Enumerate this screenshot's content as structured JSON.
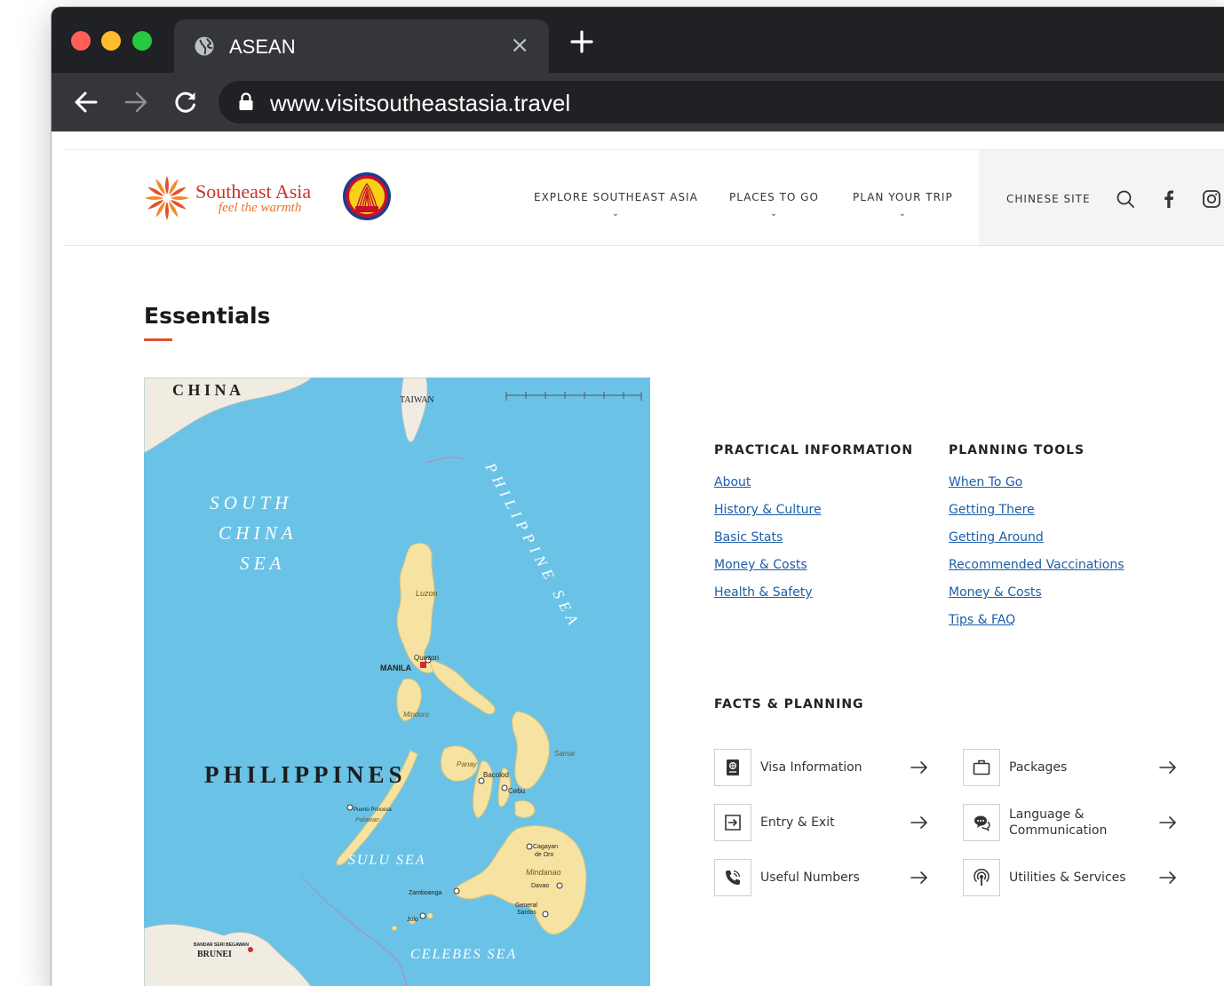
{
  "browser": {
    "tab_title": "ASEAN",
    "tab_close": "×",
    "url": "www.visitsoutheastasia.travel"
  },
  "header": {
    "brand_name": "Southeast Asia",
    "brand_tagline": "feel the warmth",
    "asean_logo_text": "asean",
    "nav": [
      {
        "label": "EXPLORE SOUTHEAST ASIA",
        "chevron": "⌄"
      },
      {
        "label": "PLACES TO GO",
        "chevron": "⌄"
      },
      {
        "label": "PLAN YOUR TRIP",
        "chevron": "⌄"
      }
    ],
    "chinese_site": "CHINESE SITE",
    "icons": [
      "search-icon",
      "facebook-icon",
      "instagram-icon"
    ]
  },
  "essentials": {
    "title": "Essentials",
    "accent_color": "#e1522c",
    "link_color": "#1c5ea8"
  },
  "map": {
    "labels": {
      "china": "C H I N A",
      "taiwan": "TAIWAN",
      "south_china_sea_1": "S O U T H",
      "south_china_sea_2": "C H I N A",
      "south_china_sea_3": "S E A",
      "philippine_sea": "PHILIPPINE SEA",
      "luzon": "Luzon",
      "quezon": "Quezon",
      "manila": "MANILA",
      "mindoro": "Mindoro",
      "philippines": "PHILIPPINES",
      "panay": "Panay",
      "samar": "Samar",
      "bacolod": "Bacolod",
      "cebu": "Cebu",
      "puerto_princesa": "Puerto Princesa",
      "palawan": "Palawan",
      "sulu_sea": "SULU SEA",
      "cagayan": "Cagayan",
      "cagayan_2": "de Oro",
      "mindanao": "Mindanao",
      "davao": "Davao",
      "zamboanga": "Zamboanga",
      "general_santos": "General",
      "general_santos_2": "Santos",
      "jolo": "Jolo",
      "bandar": "BANDAR SERI BEGAWAN",
      "brunei": "BRUNEI",
      "celebes_sea": "CELEBES SEA"
    }
  },
  "practical_information": {
    "heading": "PRACTICAL INFORMATION",
    "links": [
      "About",
      "History & Culture",
      "Basic Stats",
      "Money & Costs",
      "Health & Safety"
    ]
  },
  "planning_tools": {
    "heading": "PLANNING TOOLS",
    "links": [
      "When To Go",
      "Getting There",
      "Getting Around",
      "Recommended Vaccinations",
      "Money & Costs",
      "Tips & FAQ"
    ]
  },
  "facts_planning": {
    "heading": "FACTS & PLANNING",
    "items": [
      {
        "label": "Visa Information",
        "icon": "passport-icon"
      },
      {
        "label": "Packages",
        "icon": "briefcase-icon"
      },
      {
        "label": "Entry & Exit",
        "icon": "exit-icon"
      },
      {
        "label": "Language & Communication",
        "icon": "chat-icon"
      },
      {
        "label": "Useful Numbers",
        "icon": "phone-icon"
      },
      {
        "label": "Utilities & Services",
        "icon": "signal-icon"
      }
    ]
  }
}
